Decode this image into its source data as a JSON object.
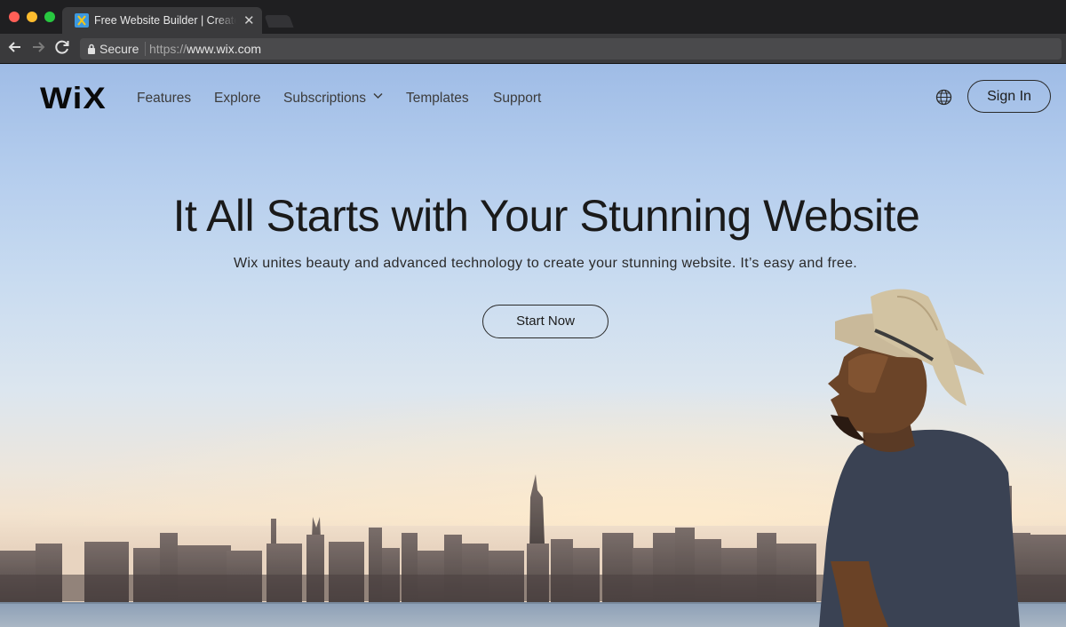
{
  "browser": {
    "tab": {
      "title": "Free Website Builder | Create a Free Website",
      "close_icon": "close-icon",
      "favicon": "wix-favicon"
    },
    "address_bar": {
      "secure_label": "Secure",
      "url_scheme": "https://",
      "url_host": "www.wix.com"
    },
    "traffic_lights": [
      "#ff5f57",
      "#febc2e",
      "#28c840"
    ]
  },
  "site": {
    "logo": "WiX",
    "nav": {
      "features": "Features",
      "explore": "Explore",
      "subscriptions": "Subscriptions",
      "templates": "Templates",
      "support": "Support"
    },
    "language_icon": "globe-icon",
    "sign_in": "Sign In",
    "hero": {
      "headline": "It All Starts with Your Stunning Website",
      "subheadline": "Wix unites beauty and advanced technology to create your stunning website. It’s easy and free.",
      "cta": "Start Now"
    }
  }
}
